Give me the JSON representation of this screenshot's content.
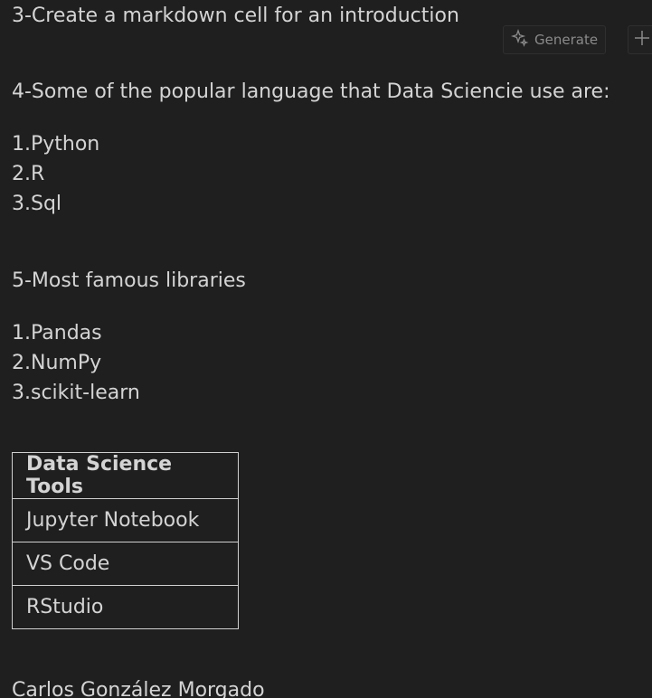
{
  "notebook": {
    "cell_intro_heading": "3-Create a markdown cell for an introduction",
    "toolbar": {
      "generate_label": "Generate",
      "generate_icon": "sparkle-icon",
      "add_icon": "plus-icon"
    },
    "languages": {
      "heading": "4-Some of the popular language that Data Sciencie use are:",
      "items": [
        "1.Python",
        "2.R",
        "3.Sql"
      ]
    },
    "libraries": {
      "heading": "5-Most famous libraries",
      "items": [
        "1.Pandas",
        "2.NumPy",
        "3.scikit-learn"
      ]
    },
    "tools_table": {
      "header": "Data Science Tools",
      "rows": [
        "Jupyter Notebook",
        "VS Code",
        "RStudio"
      ]
    },
    "author": "Carlos González Morgado"
  }
}
